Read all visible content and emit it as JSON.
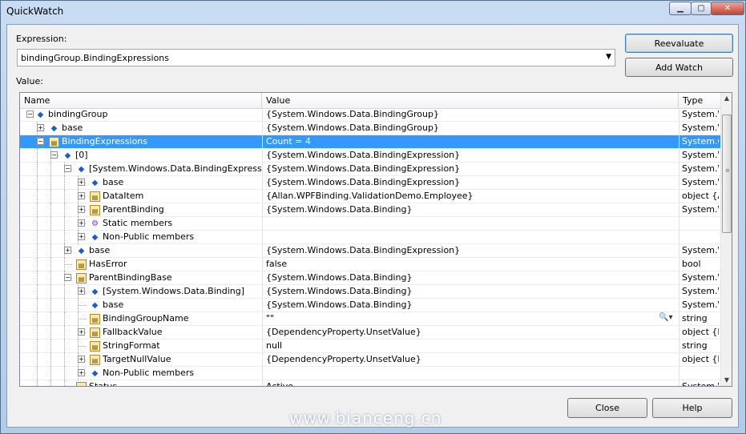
{
  "window": {
    "title": "QuickWatch",
    "minimize": "▁",
    "maximize": "▢",
    "close": "✕"
  },
  "expression": {
    "label": "Expression:",
    "value": "bindingGroup.BindingExpressions"
  },
  "value_label": "Value:",
  "buttons": {
    "reevaluate": "Reevaluate",
    "add_watch": "Add Watch",
    "close": "Close",
    "help": "Help"
  },
  "grid": {
    "columns": {
      "name": "Name",
      "value": "Value",
      "type": "Type"
    },
    "rows": [
      {
        "depth": 0,
        "exp": "−",
        "icon": "field",
        "name": "bindingGroup",
        "value": "{System.Windows.Data.BindingGroup}",
        "type": "System.W"
      },
      {
        "depth": 1,
        "exp": "+",
        "icon": "field",
        "name": "base",
        "value": "{System.Windows.Data.BindingGroup}",
        "type": "System.W"
      },
      {
        "depth": 1,
        "exp": "−",
        "icon": "prop",
        "name": "BindingExpressions",
        "value": "Count = 4",
        "type": "System.C",
        "selected": true
      },
      {
        "depth": 2,
        "exp": "−",
        "icon": "field",
        "name": "[0]",
        "value": "{System.Windows.Data.BindingExpression}",
        "type": "System.W"
      },
      {
        "depth": 3,
        "exp": "−",
        "icon": "field",
        "name": "[System.Windows.Data.BindingExpression]",
        "value": "{System.Windows.Data.BindingExpression}",
        "type": "System.W"
      },
      {
        "depth": 4,
        "exp": "+",
        "icon": "field",
        "name": "base",
        "value": "{System.Windows.Data.BindingExpression}",
        "type": "System.W"
      },
      {
        "depth": 4,
        "exp": "+",
        "icon": "prop",
        "name": "DataItem",
        "value": "{Allan.WPFBinding.ValidationDemo.Employee}",
        "type": "object {A"
      },
      {
        "depth": 4,
        "exp": "+",
        "icon": "prop",
        "name": "ParentBinding",
        "value": "{System.Windows.Data.Binding}",
        "type": "System.W"
      },
      {
        "depth": 4,
        "exp": "+",
        "icon": "static",
        "name": "Static members",
        "value": "",
        "type": ""
      },
      {
        "depth": 4,
        "exp": "+",
        "icon": "field",
        "name": "Non-Public members",
        "value": "",
        "type": ""
      },
      {
        "depth": 3,
        "exp": "+",
        "icon": "field",
        "name": "base",
        "value": "{System.Windows.Data.BindingExpression}",
        "type": "System.W"
      },
      {
        "depth": 3,
        "exp": "",
        "icon": "prop",
        "name": "HasError",
        "value": "false",
        "type": "bool"
      },
      {
        "depth": 3,
        "exp": "−",
        "icon": "prop",
        "name": "ParentBindingBase",
        "value": "{System.Windows.Data.Binding}",
        "type": "System.W"
      },
      {
        "depth": 4,
        "exp": "+",
        "icon": "field",
        "name": "[System.Windows.Data.Binding]",
        "value": "{System.Windows.Data.Binding}",
        "type": "System.W"
      },
      {
        "depth": 4,
        "exp": "",
        "icon": "field",
        "name": "base",
        "value": "{System.Windows.Data.Binding}",
        "type": "System.W"
      },
      {
        "depth": 4,
        "exp": "",
        "icon": "prop",
        "name": "BindingGroupName",
        "value": "\"\"",
        "type": "string",
        "magnify": true
      },
      {
        "depth": 4,
        "exp": "+",
        "icon": "prop",
        "name": "FallbackValue",
        "value": "{DependencyProperty.UnsetValue}",
        "type": "object {M"
      },
      {
        "depth": 4,
        "exp": "",
        "icon": "prop",
        "name": "StringFormat",
        "value": "null",
        "type": "string"
      },
      {
        "depth": 4,
        "exp": "+",
        "icon": "prop",
        "name": "TargetNullValue",
        "value": "{DependencyProperty.UnsetValue}",
        "type": "object {M"
      },
      {
        "depth": 4,
        "exp": "+",
        "icon": "field",
        "name": "Non-Public members",
        "value": "",
        "type": ""
      },
      {
        "depth": 3,
        "exp": "",
        "icon": "prop",
        "name": "Status",
        "value": "Active",
        "type": "System.W"
      }
    ]
  },
  "watermark": "www.bianceng.cn"
}
